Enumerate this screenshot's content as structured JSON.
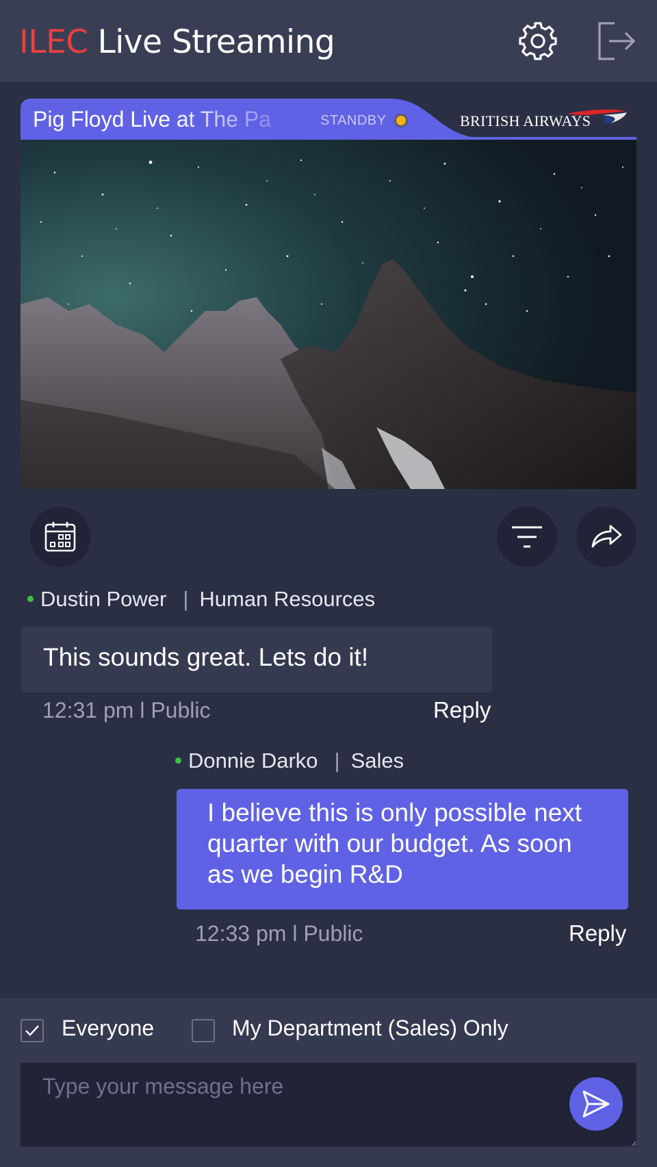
{
  "header": {
    "brand": "ILEC",
    "title": "Live Streaming",
    "brand_color": "#e8413d",
    "icons": [
      "gear-icon",
      "logout-icon"
    ]
  },
  "stream": {
    "title": "Pig Floyd Live at The Pa",
    "status": "STANDBY",
    "status_color": "#f5b30e",
    "sponsor": "BRITISH AIRWAYS",
    "tab_color": "#6062e5"
  },
  "toolbar": {
    "icons": [
      "calendar-icon",
      "filter-icon",
      "share-icon"
    ]
  },
  "messages": [
    {
      "author": "Dustin Power",
      "department": "Human Resources",
      "text": "This sounds great. Lets do it!",
      "time": "12:31 pm",
      "visibility": "Public",
      "time_line": "12:31 pm l Public",
      "reply": "Reply",
      "online": true
    },
    {
      "author": "Donnie Darko",
      "department": "Sales",
      "text": "I believe this is only possible next quarter with our budget. As soon as we begin R&D",
      "time": "12:33 pm",
      "visibility": "Public",
      "time_line": "12:33 pm l Public",
      "reply": "Reply",
      "online": true
    }
  ],
  "audience": {
    "everyone_label": "Everyone",
    "everyone_checked": true,
    "department_label": "My Department (Sales) Only",
    "department_checked": false
  },
  "composer": {
    "placeholder": "Type your message here",
    "send_icon": "send-icon",
    "accent": "#6062e5"
  }
}
